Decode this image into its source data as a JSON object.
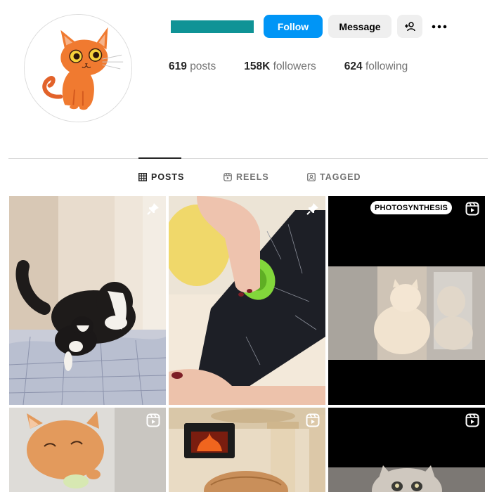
{
  "profile": {
    "avatar_alt": "orange cartoon cat",
    "buttons": {
      "follow": "Follow",
      "message": "Message",
      "add_user_icon": "person-add-icon",
      "more_icon": "more-horizontal-icon"
    },
    "stats": [
      {
        "value": "619",
        "label": "posts"
      },
      {
        "value": "158K",
        "label": "followers"
      },
      {
        "value": "624",
        "label": "following"
      }
    ]
  },
  "tabs": [
    {
      "label": "POSTS",
      "icon": "grid-icon",
      "active": true
    },
    {
      "label": "REELS",
      "icon": "reels-icon",
      "active": false
    },
    {
      "label": "TAGGED",
      "icon": "tagged-icon",
      "active": false
    }
  ],
  "grid": [
    {
      "content": "border collie and tuxedo cat on bed",
      "badge": "pin-icon"
    },
    {
      "content": "hand using green pet hair remover on black fabric",
      "badge": "pin-icon"
    },
    {
      "content": "cream cat sitting by window",
      "badge": "reel-icon",
      "caption": "PHOTOSYNTHESIS"
    },
    {
      "content": "orange kitten eating",
      "badge": "reel-icon"
    },
    {
      "content": "cat tree with fireplace",
      "badge": "reel-icon"
    },
    {
      "content": "cat peeking from bottom",
      "badge": "reel-icon"
    }
  ],
  "colors": {
    "follow": "#0095f6",
    "name_redaction": "#0f9396",
    "secondary_button": "#efefef"
  }
}
